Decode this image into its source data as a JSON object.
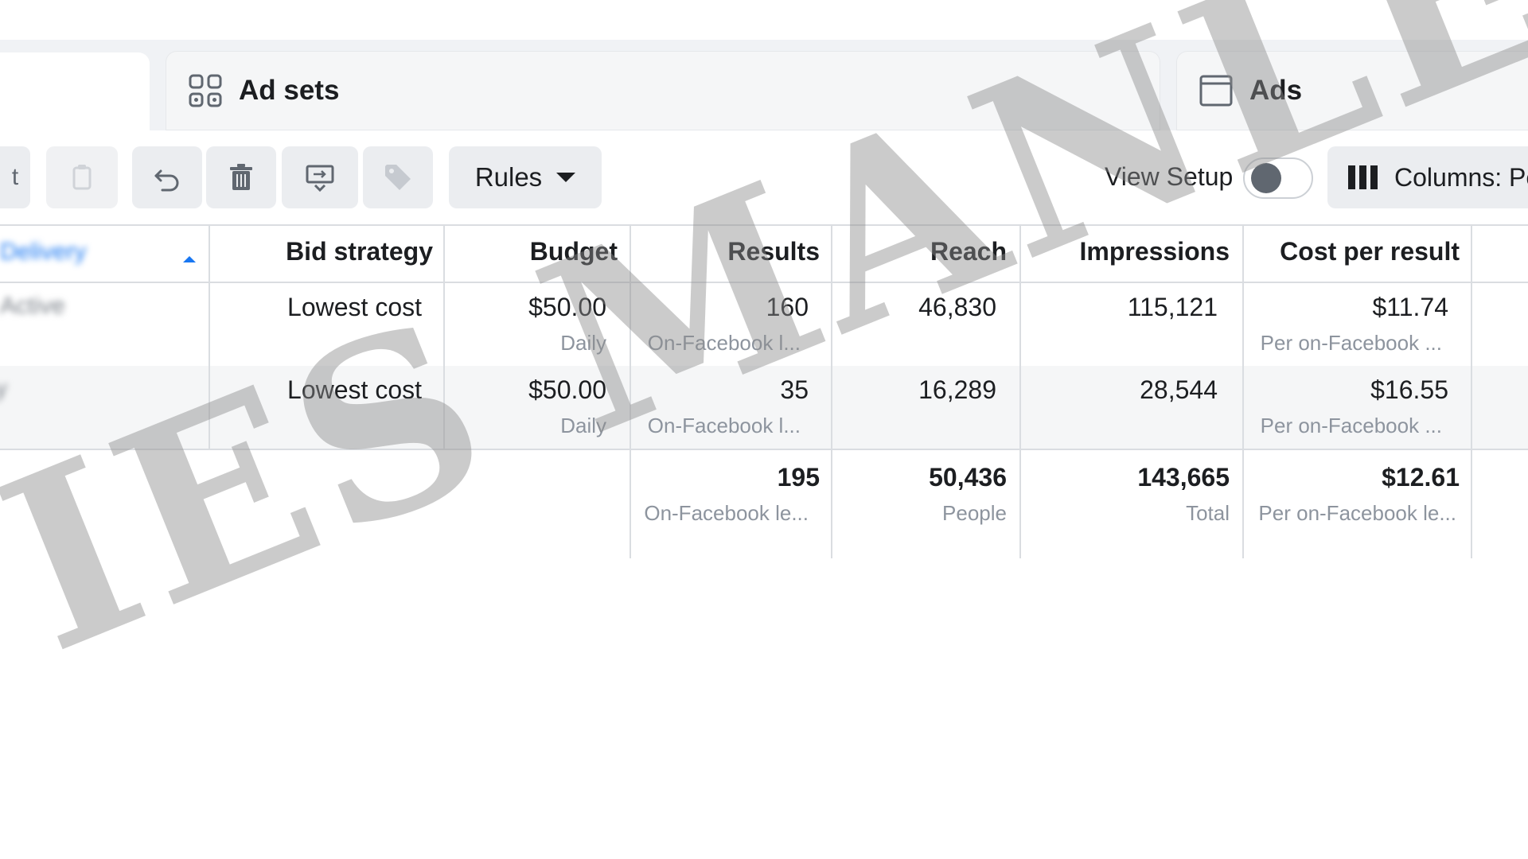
{
  "tabs": [
    {
      "label": "",
      "icon": "campaigns-icon",
      "active": true
    },
    {
      "label": "Ad sets",
      "icon": "ad-sets-grid-icon",
      "active": false
    },
    {
      "label": "Ads",
      "icon": "ads-window-icon",
      "active": false
    }
  ],
  "toolbar": {
    "buttons": [
      "edit",
      "duplicate-icon",
      "undo-icon",
      "delete-icon",
      "export-icon",
      "tag-icon"
    ],
    "rules_label": "Rules",
    "view_setup_label": "View Setup",
    "view_setup_on": false,
    "columns_label": "Columns: Pe"
  },
  "table": {
    "first_column_header": "Delivery",
    "headers": [
      "Bid strategy",
      "Budget",
      "Results",
      "Reach",
      "Impressions",
      "Cost per result"
    ],
    "rows": [
      {
        "delivery": "Active",
        "bid_strategy": "Lowest cost",
        "budget": "$50.00",
        "budget_sub": "Daily",
        "results": "160",
        "results_sub": "On-Facebook l...",
        "reach": "46,830",
        "impressions": "115,121",
        "cost_per_result": "$11.74",
        "cost_per_result_sub": "Per on-Facebook ..."
      },
      {
        "delivery": "y",
        "bid_strategy": "Lowest cost",
        "budget": "$50.00",
        "budget_sub": "Daily",
        "results": "35",
        "results_sub": "On-Facebook l...",
        "reach": "16,289",
        "impressions": "28,544",
        "cost_per_result": "$16.55",
        "cost_per_result_sub": "Per on-Facebook ..."
      }
    ],
    "totals": {
      "results": "195",
      "results_sub": "On-Facebook le...",
      "reach": "50,436",
      "reach_sub": "People",
      "impressions": "143,665",
      "impressions_sub": "Total",
      "cost_per_result": "$12.61",
      "cost_per_result_sub": "Per on-Facebook le..."
    }
  },
  "watermark": "IES MANLEY"
}
